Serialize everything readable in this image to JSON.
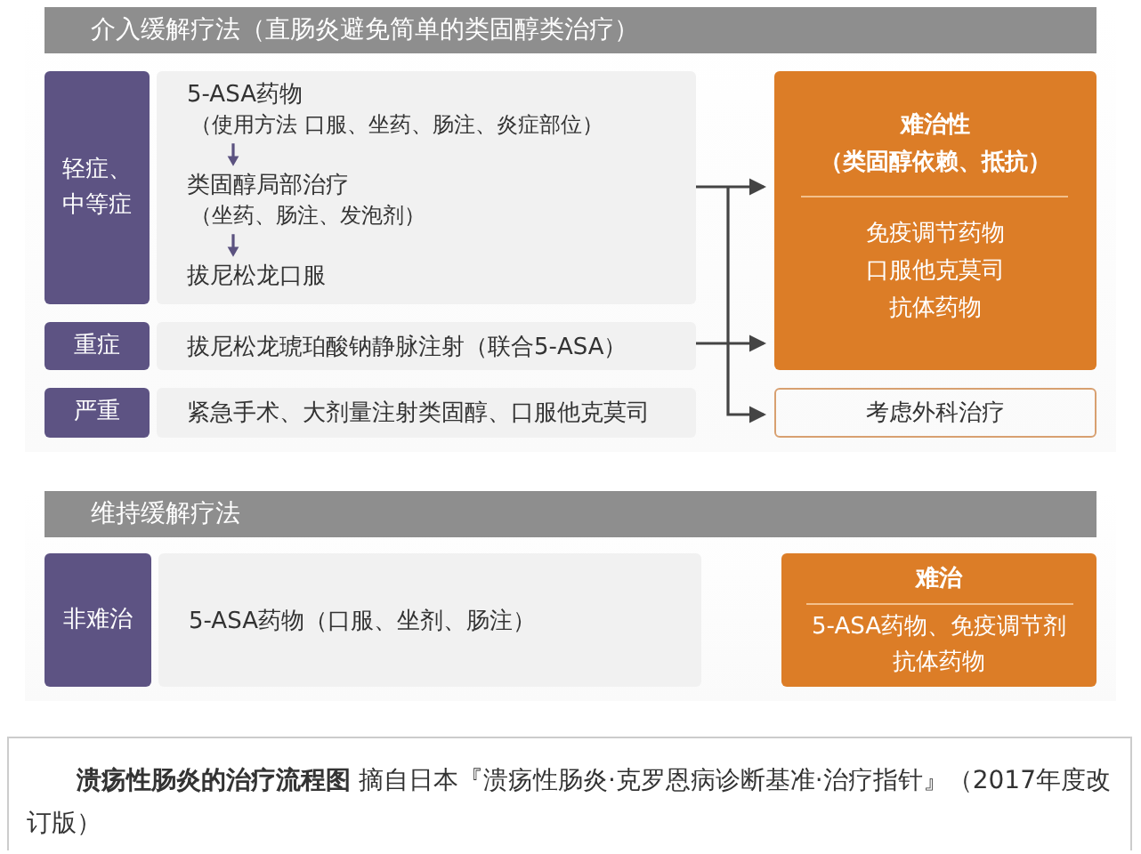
{
  "induction": {
    "title": "介入缓解疗法（直肠炎避免简单的类固醇类治疗）",
    "rows": [
      {
        "kind": "steps",
        "label_lines": [
          "轻症、",
          "中等症"
        ],
        "steps": [
          {
            "name": "5-ASA药物",
            "note": "（使用方法 口服、坐药、肠注、炎症部位）"
          },
          {
            "name": "类固醇局部治疗",
            "note": "（坐药、肠注、发泡剂）"
          },
          {
            "name": "拔尼松龙口服"
          }
        ]
      },
      {
        "kind": "text",
        "label_lines": [
          "重症"
        ],
        "text": "拔尼松龙琥珀酸钠静脉注射（联合5-ASA）"
      },
      {
        "kind": "text",
        "label_lines": [
          "严重"
        ],
        "text": "紧急手术、大剂量注射类固醇、口服他克莫司"
      }
    ],
    "outcomes": [
      {
        "kind": "filled",
        "title_lines": [
          "难治性",
          "（类固醇依赖、抵抗）"
        ],
        "lines": [
          "免疫调节药物",
          "口服他克莫司",
          "抗体药物"
        ]
      },
      {
        "kind": "outlined",
        "title_lines": [
          "考虑外科治疗"
        ]
      }
    ]
  },
  "maintenance": {
    "title": "维持缓解疗法",
    "label": "非难治",
    "text": "5-ASA药物（口服、坐剂、肠注）",
    "outcome": {
      "title": "难治",
      "lines": [
        "5-ASA药物、免疫调节剂",
        "抗体药物"
      ]
    }
  },
  "caption": "**溃疡性肠炎的治疗流程图** 摘自日本『溃疡性肠炎·克罗恩病诊断基准·治疗指针』（2017年度改订版）"
}
